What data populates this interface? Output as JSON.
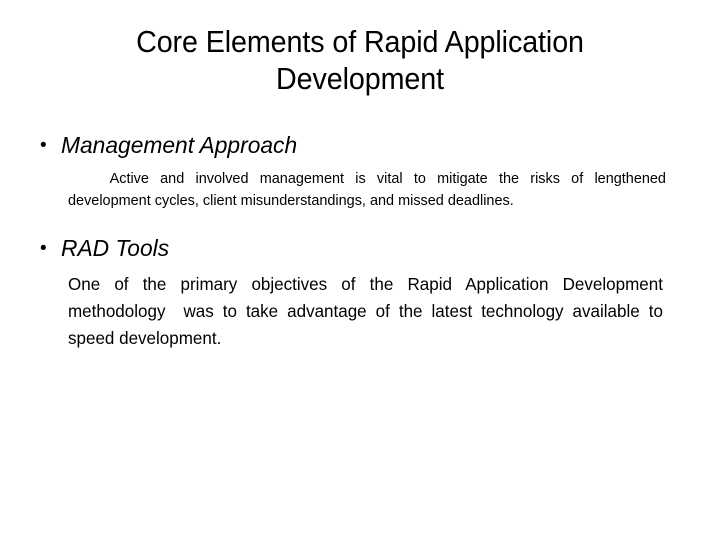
{
  "slide": {
    "background_color": "#ffffff",
    "text_color": "#000000",
    "title": "Core Elements of Rapid Application Development",
    "bullet_glyph": "•",
    "sections": [
      {
        "heading": "Management Approach",
        "body": "Active and involved management is vital to mitigate the risks of lengthened development cycles, client misunderstandings, and missed deadlines."
      },
      {
        "heading": "RAD Tools",
        "body": "One of the primary objectives of the Rapid Application Development methodology  was to take advantage of the latest technology available to speed development."
      }
    ]
  }
}
